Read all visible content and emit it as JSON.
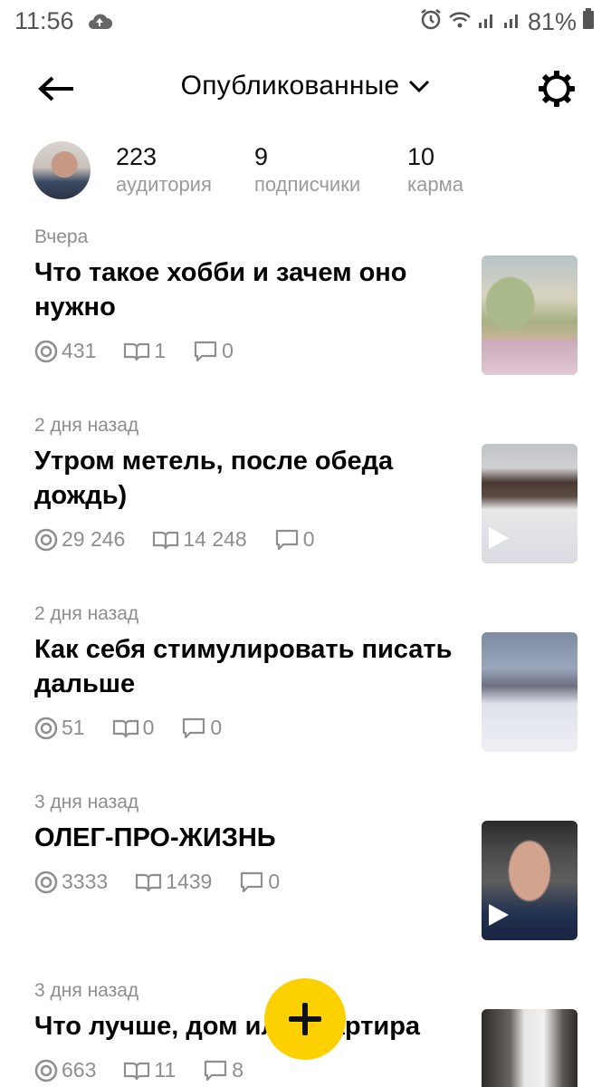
{
  "status_bar": {
    "time": "11:56",
    "battery": "81%"
  },
  "header": {
    "title": "Опубликованные"
  },
  "profile": {
    "stats": [
      {
        "value": "223",
        "label": "аудитория"
      },
      {
        "value": "9",
        "label": "подписчики"
      },
      {
        "value": "10",
        "label": "карма"
      }
    ]
  },
  "posts": [
    {
      "date": "Вчера",
      "title": "Что такое хобби и зачем оно нужно",
      "views": "431",
      "reads": "1",
      "comments": "0",
      "video": false
    },
    {
      "date": "2 дня назад",
      "title": "Утром метель, после обеда дождь)",
      "views": "29 246",
      "reads": "14 248",
      "comments": "0",
      "video": true
    },
    {
      "date": "2 дня назад",
      "title": "Как себя стимулировать писать дальше",
      "views": "51",
      "reads": "0",
      "comments": "0",
      "video": false
    },
    {
      "date": "3 дня назад",
      "title": "ОЛЕГ-ПРО-ЖИЗНЬ",
      "views": "3333",
      "reads": "1439",
      "comments": "0",
      "video": true
    },
    {
      "date": "3 дня назад",
      "title": "Что лучше, дом или квартира",
      "views": "663",
      "reads": "11",
      "comments": "8",
      "video": false
    }
  ],
  "colors": {
    "fab": "#fdd000",
    "muted_text": "#8e8e8e"
  }
}
